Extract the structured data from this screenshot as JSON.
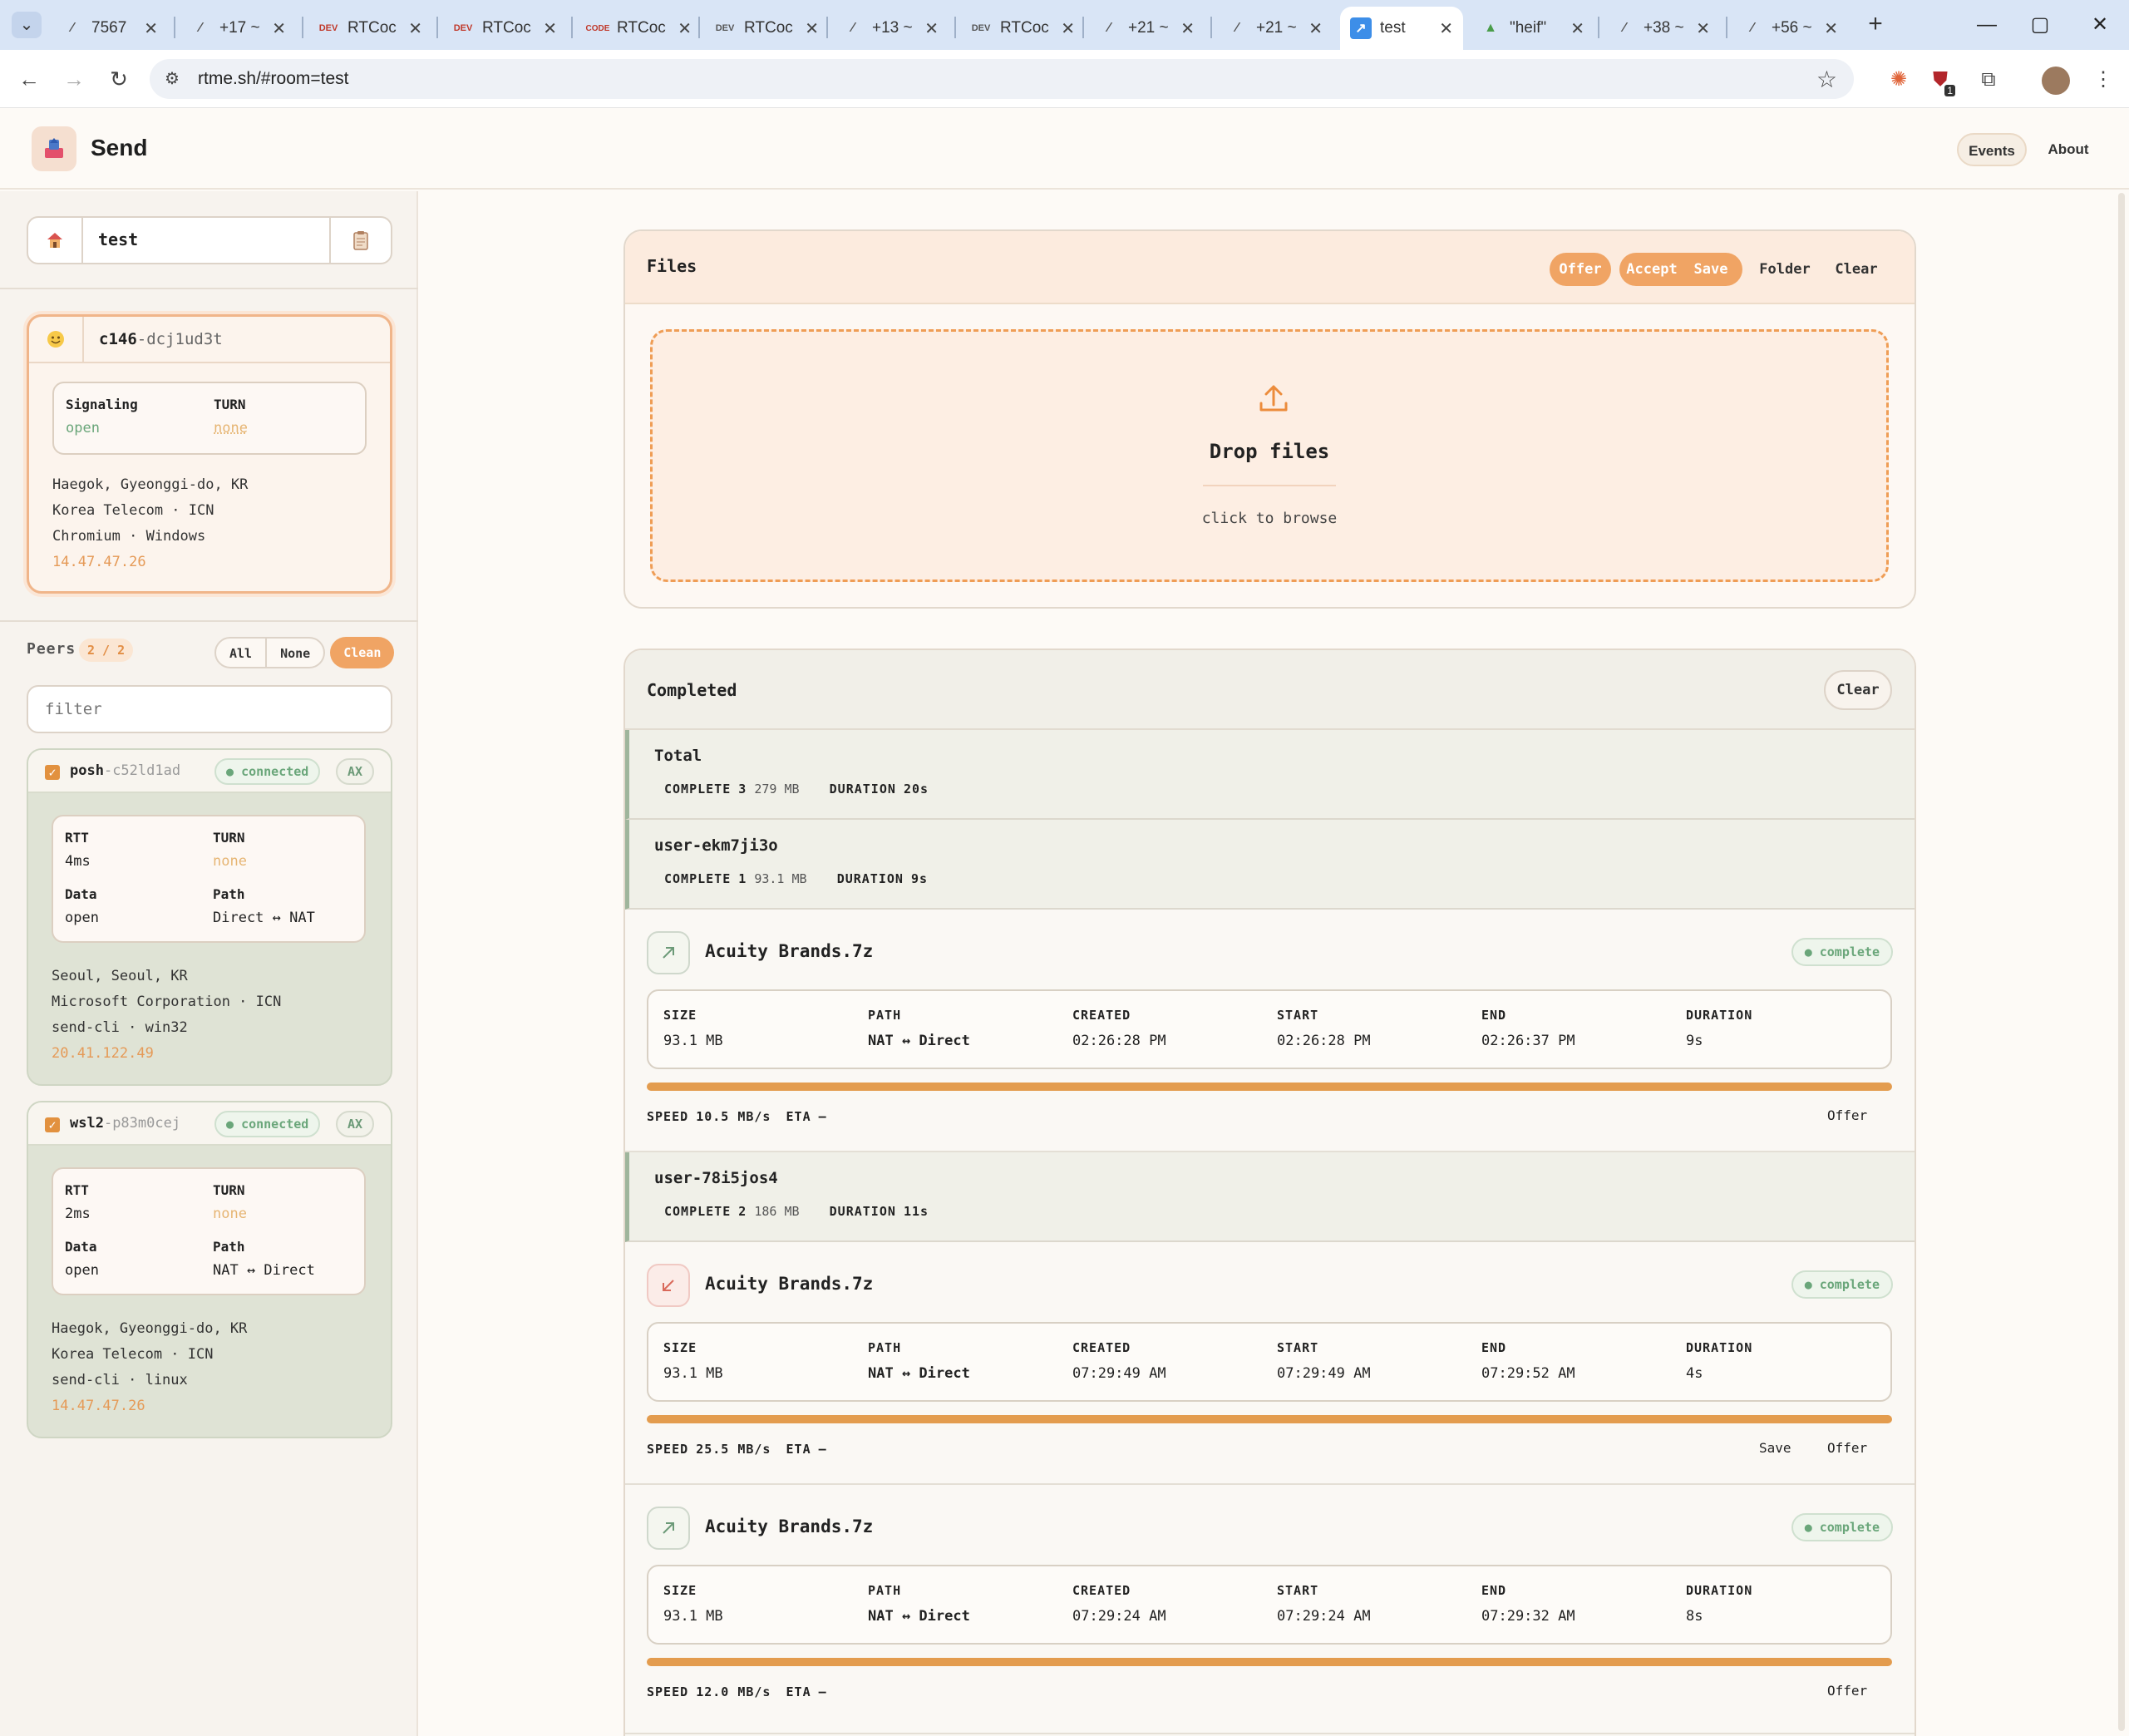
{
  "browser": {
    "tabs": [
      {
        "label": "7567",
        "icon": "diff-icon"
      },
      {
        "label": "+17 ~",
        "icon": "diff-icon"
      },
      {
        "label": "RTCoc",
        "icon": "dev-icon"
      },
      {
        "label": "RTCoc",
        "icon": "dev-icon"
      },
      {
        "label": "RTCoc",
        "icon": "code-icon"
      },
      {
        "label": "RTCoc",
        "icon": "dev-icon"
      },
      {
        "label": "+13 ~",
        "icon": "diff-icon"
      },
      {
        "label": "RTCoc",
        "icon": "dev-icon"
      },
      {
        "label": "+21 ~",
        "icon": "diff-icon"
      },
      {
        "label": "+21 ~",
        "icon": "diff-icon"
      },
      {
        "label": "test",
        "icon": "send-app-icon",
        "active": true
      },
      {
        "label": "\"heif\"",
        "icon": "image-icon"
      },
      {
        "label": "+38 ~",
        "icon": "diff-icon"
      },
      {
        "label": "+56 ~",
        "icon": "diff-icon"
      }
    ],
    "url": "rtme.sh/#room=test",
    "extension_badge": "1"
  },
  "app": {
    "title": "Send",
    "nav": {
      "events": "Events",
      "about": "About"
    }
  },
  "sidebar": {
    "room": "test",
    "self": {
      "id_prefix": "c146",
      "id_suffix": "-dcj1ud3t",
      "signaling_label": "Signaling",
      "signaling_value": "open",
      "turn_label": "TURN",
      "turn_value": "none",
      "location": "Haegok, Gyeonggi-do, KR",
      "isp": "Korea Telecom · ICN",
      "client": "Chromium · Windows",
      "ip": "14.47.47.26"
    },
    "peers_label": "Peers",
    "peer_count": "2",
    "peer_total": "2",
    "buttons": {
      "all": "All",
      "none": "None",
      "clean": "Clean"
    },
    "filter_placeholder": "filter",
    "peers": [
      {
        "name": "posh",
        "suffix": "-c52ld1ad",
        "status": "connected",
        "tag": "AX",
        "rtt": "4ms",
        "turn": "none",
        "data": "open",
        "path": "Direct ↔ NAT",
        "location": "Seoul, Seoul, KR",
        "isp": "Microsoft Corporation · ICN",
        "client": "send-cli · win32",
        "ip": "20.41.122.49"
      },
      {
        "name": "wsl2",
        "suffix": "-p83m0cej",
        "status": "connected",
        "tag": "AX",
        "rtt": "2ms",
        "turn": "none",
        "data": "open",
        "path": "NAT ↔ Direct",
        "location": "Haegok, Gyeonggi-do, KR",
        "isp": "Korea Telecom · ICN",
        "client": "send-cli · linux",
        "ip": "14.47.47.26"
      }
    ],
    "labels": {
      "rtt": "RTT",
      "turn": "TURN",
      "data": "Data",
      "path": "Path"
    }
  },
  "files": {
    "title": "Files",
    "buttons": {
      "offer": "Offer",
      "accept": "Accept",
      "save": "Save",
      "folder": "Folder",
      "clear": "Clear"
    },
    "drop_title": "Drop files",
    "drop_hint": "click to browse"
  },
  "completed": {
    "title": "Completed",
    "clear": "Clear",
    "stat_labels": {
      "complete": "COMPLETE",
      "duration": "DURATION"
    },
    "total": {
      "name": "Total",
      "count": "3",
      "size": "279 MB",
      "duration": "20s"
    },
    "users": [
      {
        "name": "user-ekm7ji3o",
        "count": "1",
        "size": "93.1 MB",
        "duration": "9s"
      },
      {
        "name": "user-78i5jos4",
        "count": "2",
        "size": "186 MB",
        "duration": "11s"
      }
    ],
    "detail_labels": {
      "size": "SIZE",
      "path": "PATH",
      "created": "CREATED",
      "start": "START",
      "end": "END",
      "duration": "DURATION",
      "speed": "SPEED",
      "eta": "ETA"
    },
    "transfers": [
      {
        "name": "Acuity Brands.7z",
        "direction": "outgoing",
        "status": "complete",
        "size": "93.1 MB",
        "path": "NAT ↔ Direct",
        "created": "02:26:28 PM",
        "start": "02:26:28 PM",
        "end": "02:26:37 PM",
        "duration": "9s",
        "progress": 1.0,
        "speed": "10.5 MB/s",
        "eta": "—",
        "actions": [
          "Offer"
        ]
      },
      {
        "name": "Acuity Brands.7z",
        "direction": "incoming",
        "status": "complete",
        "size": "93.1 MB",
        "path": "NAT ↔ Direct",
        "created": "07:29:49 AM",
        "start": "07:29:49 AM",
        "end": "07:29:52 AM",
        "duration": "4s",
        "progress": 1.0,
        "speed": "25.5 MB/s",
        "eta": "—",
        "actions": [
          "Save",
          "Offer"
        ]
      },
      {
        "name": "Acuity Brands.7z",
        "direction": "outgoing",
        "status": "complete",
        "size": "93.1 MB",
        "path": "NAT ↔ Direct",
        "created": "07:29:24 AM",
        "start": "07:29:24 AM",
        "end": "07:29:32 AM",
        "duration": "8s",
        "progress": 1.0,
        "speed": "12.0 MB/s",
        "eta": "—",
        "actions": [
          "Offer"
        ]
      }
    ]
  },
  "colors": {
    "accent": "#f0a464",
    "connected": "#6aa67a",
    "ip": "#e59a57"
  }
}
